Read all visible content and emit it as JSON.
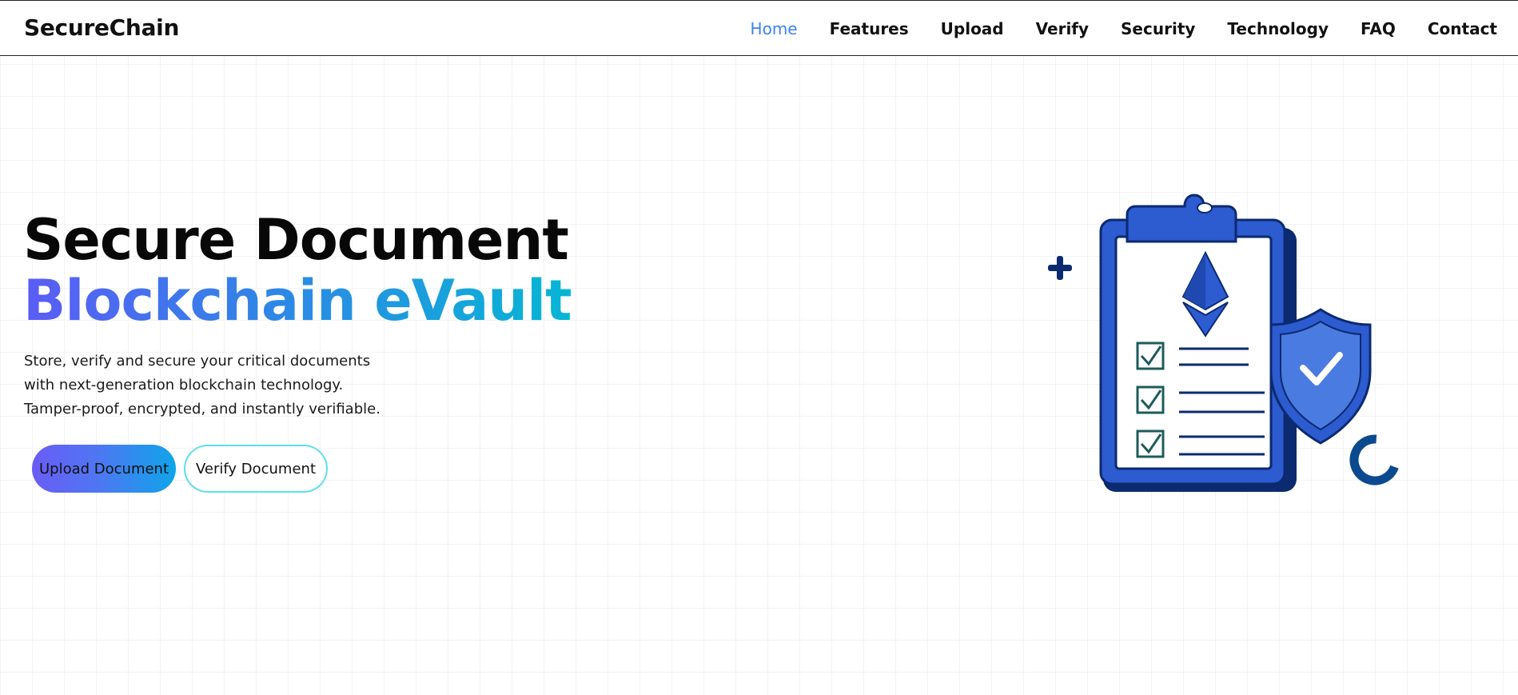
{
  "brand": "SecureChain",
  "nav": {
    "items": [
      "Home",
      "Features",
      "Upload",
      "Verify",
      "Security",
      "Technology",
      "FAQ",
      "Contact"
    ],
    "active": "Home"
  },
  "hero": {
    "title_line1": "Secure Document",
    "title_line2": "Blockchain eVault",
    "description": "Store, verify and secure your critical documents with next-generation blockchain technology. Tamper-proof, encrypted, and instantly verifiable.",
    "primary_button": "Upload Document",
    "secondary_button": "Verify Document"
  },
  "colors": {
    "nav_active": "#3b82f6",
    "gradient_start": "#5b5cf6",
    "gradient_end": "#06b6d4",
    "outline_border": "#5ee0ea",
    "illustration_primary": "#2d5bd0",
    "illustration_dark": "#0b2a6f"
  },
  "illustration": {
    "icons": [
      "clipboard-icon",
      "ethereum-icon",
      "checkbox-icon",
      "shield-check-icon",
      "plus-icon",
      "loading-ring-icon"
    ]
  }
}
